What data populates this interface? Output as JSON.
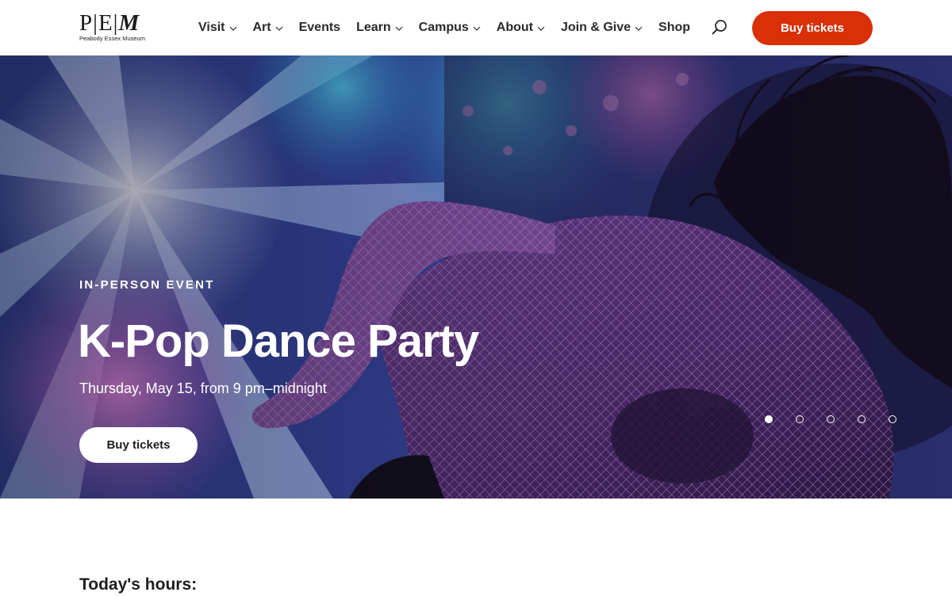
{
  "header": {
    "logo": {
      "letters": [
        "P",
        "E",
        "M"
      ],
      "subtitle": "Peabody Essex Museum"
    },
    "nav": [
      {
        "label": "Visit",
        "has_dropdown": true
      },
      {
        "label": "Art",
        "has_dropdown": true
      },
      {
        "label": "Events",
        "has_dropdown": false
      },
      {
        "label": "Learn",
        "has_dropdown": true
      },
      {
        "label": "Campus",
        "has_dropdown": true
      },
      {
        "label": "About",
        "has_dropdown": true
      },
      {
        "label": "Join & Give",
        "has_dropdown": true
      },
      {
        "label": "Shop",
        "has_dropdown": false
      }
    ],
    "search_icon": "search-icon",
    "cta_label": "Buy tickets"
  },
  "hero": {
    "eyebrow": "IN-PERSON EVENT",
    "title": "K-Pop Dance Party",
    "subtitle": "Thursday, May 15, from 9 pm–midnight",
    "cta_label": "Buy tickets",
    "slide_count": 5,
    "active_slide": 1
  },
  "content": {
    "hours_heading": "Today's hours:"
  },
  "colors": {
    "accent": "#d9300a",
    "text": "#2a2a2a",
    "hero_overlay": "#2b2d63"
  }
}
